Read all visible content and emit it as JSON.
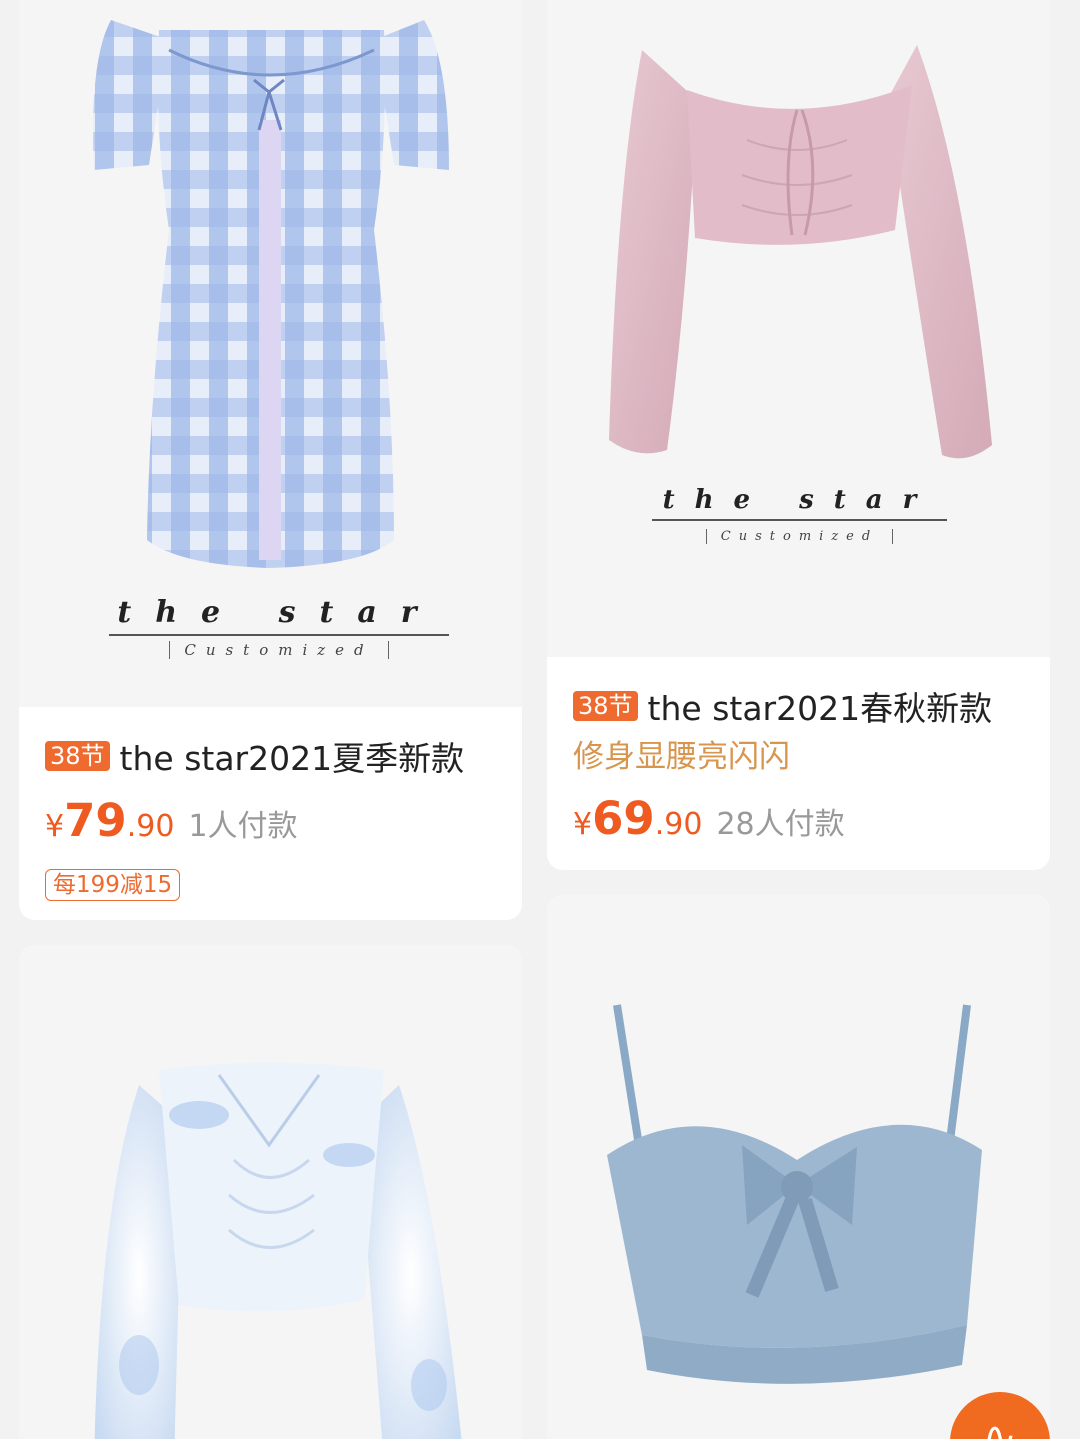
{
  "products": [
    {
      "tag": "38节",
      "title": "the star2021夏季新款",
      "subtitle": "",
      "currency": "¥",
      "price_int": "79",
      "price_dec": ".90",
      "sold": "1人付款",
      "promo": "每199减15",
      "brand_main": "the star",
      "brand_sub": "Customized"
    },
    {
      "tag": "38节",
      "title": "the star2021春秋新款",
      "subtitle": "修身显腰亮闪闪",
      "currency": "¥",
      "price_int": "69",
      "price_dec": ".90",
      "sold": "28人付款",
      "promo": "",
      "brand_main": "the star",
      "brand_sub": "Customized"
    },
    {
      "tag": "",
      "title": "",
      "subtitle": "",
      "currency": "",
      "price_int": "",
      "price_dec": "",
      "sold": "",
      "promo": "",
      "brand_main": "",
      "brand_sub": ""
    },
    {
      "tag": "",
      "title": "",
      "subtitle": "",
      "currency": "",
      "price_int": "",
      "price_dec": "",
      "sold": "",
      "promo": "",
      "brand_main": "",
      "brand_sub": ""
    }
  ],
  "icons": {
    "cart": "cart-icon"
  },
  "colors": {
    "accent": "#ee5a1f",
    "tag_bg": "#ee6a2f",
    "subtitle": "#d8954d",
    "page_bg": "#f2f2f2"
  }
}
